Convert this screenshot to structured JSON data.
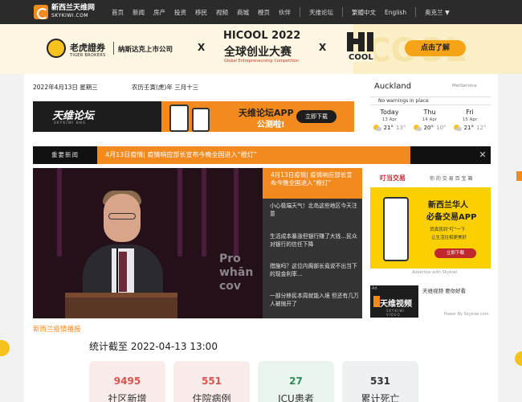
{
  "site": {
    "logo_cn": "新西兰天维网",
    "logo_en": "SKYKIWI.COM"
  },
  "nav": {
    "items": [
      "首页",
      "新闻",
      "房产",
      "投资",
      "移民",
      "视频",
      "商城",
      "橙页",
      "伙伴"
    ],
    "forum": "天维论坛",
    "lang_cn": "繁體中文",
    "lang_en": "English",
    "user": "奥克兰 ▼"
  },
  "banner": {
    "tiger_cn": "老虎證券",
    "tiger_en": "TIGER BROKERS",
    "nasdaq": "纳斯达克上市公司",
    "x": "X",
    "hicool_title": "HICOOL 2022",
    "hicool_cn": "全球创业大赛",
    "hicool_en": "Global Entrepreneurship Competition",
    "hicool_logo": "COOL",
    "cta": "点击了解",
    "deco": "COOL",
    "colors": {
      "accent": "#f5a418",
      "bg": "#fdf6e3"
    }
  },
  "dateline": {
    "date": "2022年4月13日 星期三",
    "lunar": "农历壬寅(虎)年 三月十三"
  },
  "forum_ad": {
    "logo": "天维论坛",
    "sub": "SKYKIWI BBS",
    "title": "天维论坛APP",
    "title2": "公测啦!",
    "button": "立即下载"
  },
  "weather": {
    "city": "Auckland",
    "brand": "MetService",
    "warning": "No warnings in place",
    "days": [
      {
        "name": "Today",
        "date": "13 Apr",
        "hi": "21°",
        "lo": "13°"
      },
      {
        "name": "Thu",
        "date": "14 Apr",
        "hi": "20°",
        "lo": "10°"
      },
      {
        "name": "Fri",
        "date": "15 Apr",
        "hi": "21°",
        "lo": "12°"
      }
    ]
  },
  "breaking": {
    "label": "重要新闻",
    "headline": "4月13日疫情| 疫情响应部长宣布今晚全国进入“橙灯”",
    "close": "✕"
  },
  "hero": {
    "overlay": "Pro\nwhān\ncov"
  },
  "side_news": {
    "feature": "4月13日疫情| 疫情响应部长宣布今晚全国进入“橙灯”",
    "items": [
      "小心极端天气！北岛这些地区今天注意",
      "生活成本暴涨但银行赚了大钱…民众对银行的信任下降",
      "措施吗？这位内阁部长竟说不出当下的现金利率…",
      "一部分移民本周就能入境 但还有几万人被抛开了"
    ]
  },
  "trade_ad": {
    "logo": "叮当交易",
    "tagline": "你 的 交 易 百 宝 箱",
    "title1": "新西兰华人",
    "title2": "必备交易APP",
    "line1": "货真就到“叮”一下",
    "line2": "让生活往相更美好",
    "button": "立即下载",
    "caption": "Advertise with Skykiwi"
  },
  "video": {
    "ad_tag": "Ad",
    "logo": "天维视频",
    "sub": "SKYKIWI VIDEO",
    "text": "天维视频 要你好看",
    "powered": "Power By Skykiwi.com"
  },
  "covid": {
    "title": "新西兰疫情播报",
    "stats_title": "统计截至 2022-04-13 13:00",
    "stats": [
      {
        "value": "9495",
        "label": "社区新增",
        "color": "#d9534f",
        "bg": "#fbecec"
      },
      {
        "value": "551",
        "label": "住院病例",
        "color": "#d9534f",
        "bg": "#fbecec"
      },
      {
        "value": "27",
        "label": "ICU患者",
        "color": "#2e8b57",
        "bg": "#eaf5ee"
      },
      {
        "value": "531",
        "label": "累计死亡",
        "color": "#333333",
        "bg": "#eef0f3"
      }
    ]
  }
}
